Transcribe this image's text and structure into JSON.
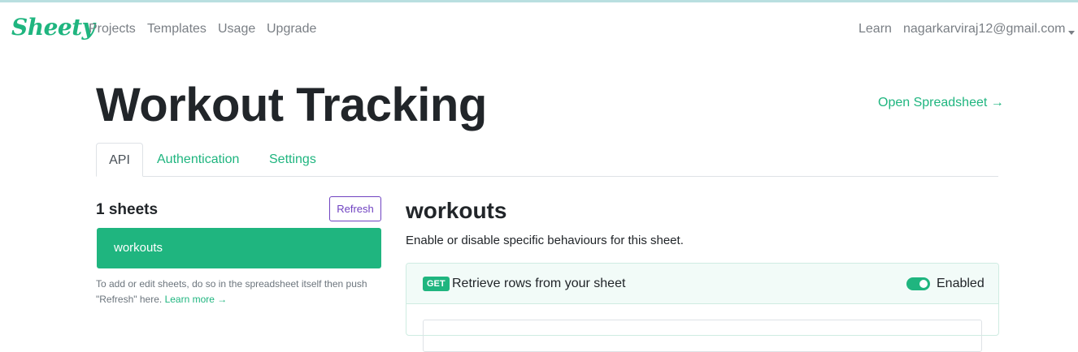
{
  "navbar": {
    "logo": "Sheety",
    "links": [
      "Projects",
      "Templates",
      "Usage",
      "Upgrade"
    ],
    "learn": "Learn",
    "user": "nagarkarviraj12@gmail.com"
  },
  "page": {
    "title": "Workout Tracking",
    "open_spreadsheet": "Open Spreadsheet →"
  },
  "tabs": [
    "API",
    "Authentication",
    "Settings"
  ],
  "sidebar": {
    "count_label": "1 sheets",
    "refresh_label": "Refresh",
    "sheets": [
      "workouts"
    ],
    "help_text": "To add or edit sheets, do so in the spreadsheet itself then push \"Refresh\" here.",
    "help_link": "Learn more →"
  },
  "main": {
    "sheet_title": "workouts",
    "description": "Enable or disable specific behaviours for this sheet.",
    "endpoint": {
      "method": "GET",
      "label": "Retrieve rows from your sheet",
      "status": "Enabled"
    }
  },
  "colors": {
    "brand": "#1fb57f",
    "refresh_accent": "#6f42c1"
  }
}
